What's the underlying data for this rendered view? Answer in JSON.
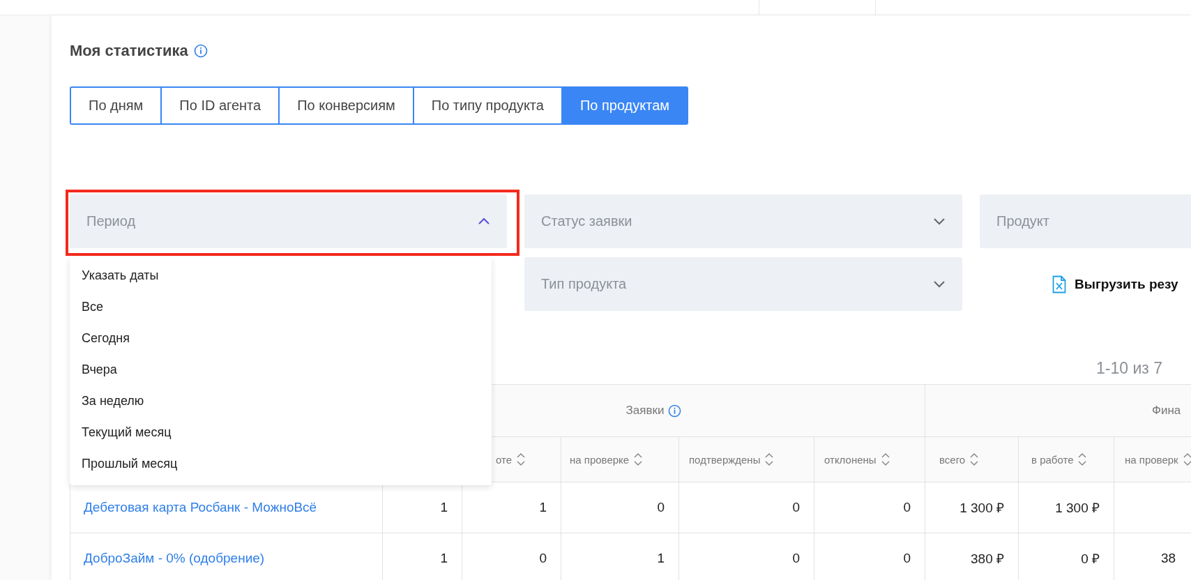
{
  "title": {
    "text": "Моя статистика",
    "info": true
  },
  "tabs": [
    {
      "label": "По дням",
      "selected": false
    },
    {
      "label": "По ID агента",
      "selected": false
    },
    {
      "label": "По конверсиям",
      "selected": false
    },
    {
      "label": "По типу продукта",
      "selected": false
    },
    {
      "label": "По продуктам",
      "selected": true
    }
  ],
  "filters": [
    {
      "placeholder": "Период",
      "expanded": true,
      "highlighted": true
    },
    {
      "placeholder": "Статус заявки",
      "expanded": false
    },
    {
      "placeholder": "Продукт"
    },
    {
      "placeholder": "Тип продукта",
      "expanded": false
    }
  ],
  "period_options": [
    "Указать даты",
    "Все",
    "Сегодня",
    "Вчера",
    "За неделю",
    "Текущий месяц",
    "Прошлый месяц"
  ],
  "export_button": "Выгрузить резу",
  "pagination": "1-10 из 7",
  "table": {
    "groups": [
      {
        "label": "Заявки",
        "info": true
      },
      {
        "label": "Фина",
        "info": false
      }
    ],
    "columns": [
      "",
      "оте",
      "на проверке",
      "подтверждены",
      "отклонены",
      "всего",
      "в работе",
      "на проверк"
    ],
    "rows": [
      {
        "product": "Дебетовая карта Росбанк - МожноВсё",
        "cells": [
          "1",
          "1",
          "0",
          "0",
          "0",
          "1 300 ₽",
          "1 300 ₽"
        ]
      },
      {
        "product": "ДоброЗайм - 0% (одобрение)",
        "cells": [
          "1",
          "0",
          "1",
          "0",
          "0",
          "380 ₽",
          "0 ₽",
          "38"
        ]
      }
    ]
  }
}
